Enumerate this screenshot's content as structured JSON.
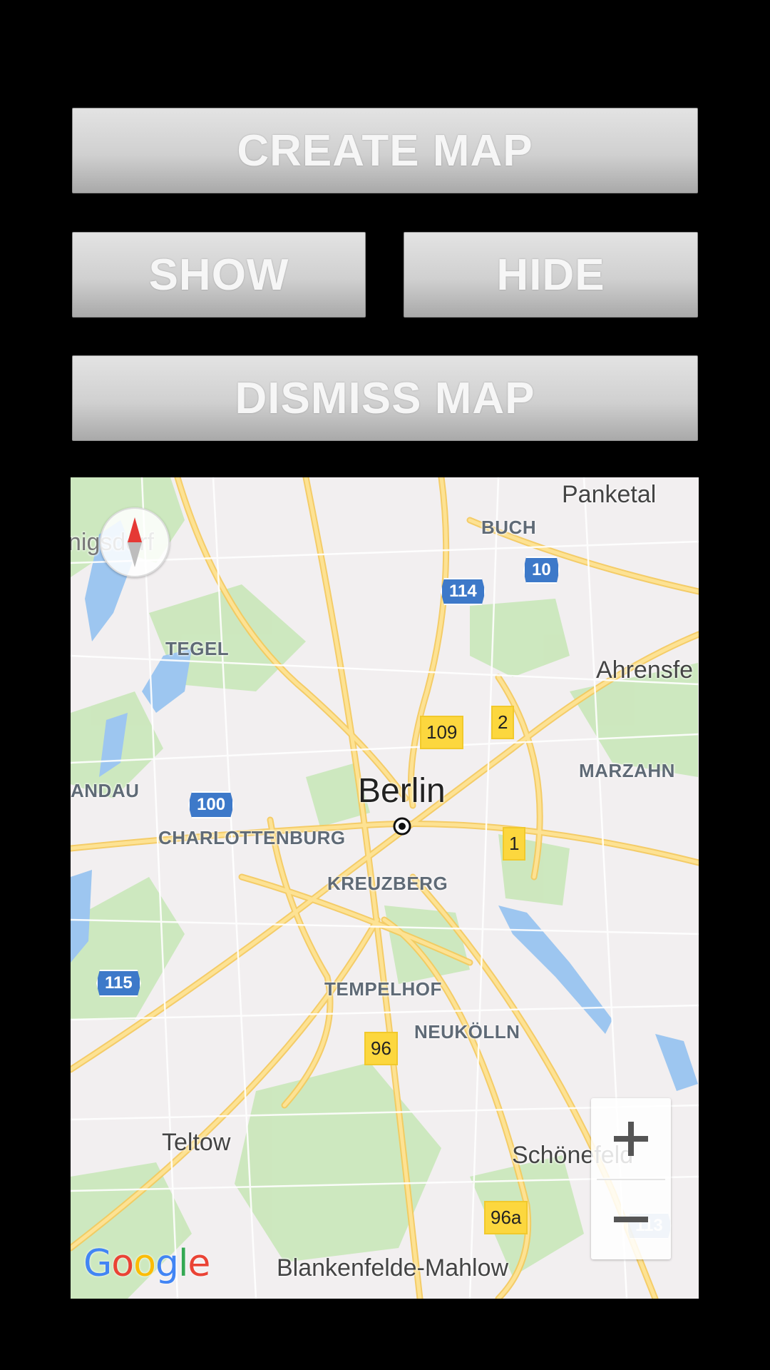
{
  "buttons": {
    "create_map": "CREATE MAP",
    "show": "SHOW",
    "hide": "HIDE",
    "dismiss_map": "DISMISS MAP"
  },
  "map": {
    "labels": {
      "panketal": "Panketal",
      "buch": "BUCH",
      "konigsdorf_partial": "nigsdorf",
      "tegel": "TEGEL",
      "ahrensfelde_partial": "Ahrensfe",
      "marzahn": "MARZAHN",
      "spandau_partial": "ANDAU",
      "berlin": "Berlin",
      "charlottenburg": "CHARLOTTENBURG",
      "kreuzberg": "KREUZBERG",
      "tempelhof": "TEMPELHOF",
      "neukolln": "NEUKÖLLN",
      "teltow": "Teltow",
      "schonefeld": "Schönefeld",
      "blankenfelde": "Blankenfelde-Mahlow"
    },
    "road_shields": {
      "a114": "114",
      "a10": "10",
      "a100": "100",
      "a115": "115",
      "a113": "113",
      "b109": "109",
      "b2": "2",
      "b1": "1",
      "b96": "96",
      "b96a": "96a"
    },
    "compass_icon": "compass-icon",
    "zoom_in_icon": "plus-icon",
    "zoom_out_icon": "minus-icon",
    "logo": [
      "G",
      "o",
      "o",
      "g",
      "l",
      "e"
    ],
    "colors": {
      "water": "#9dc6f0",
      "park": "#c9e7b9",
      "road": "#fde293",
      "road_border": "#f5c95a",
      "land": "#f2eff0"
    }
  }
}
